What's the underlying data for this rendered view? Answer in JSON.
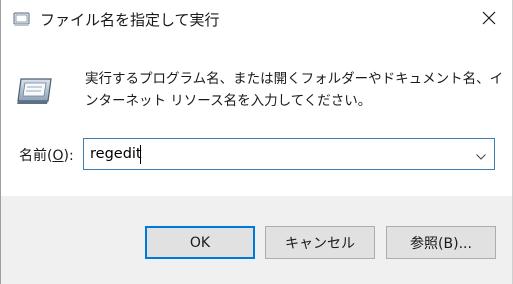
{
  "window": {
    "title": "ファイル名を指定して実行",
    "title_icon": "run-dialog-icon",
    "close_icon": "close-icon"
  },
  "main": {
    "icon": "run-program-icon",
    "description": "実行するプログラム名、または開くフォルダーやドキュメント名、インターネット リソース名を入力してください。",
    "open_label_main": "名前(",
    "open_label_key": "O",
    "open_label_end": "):",
    "command_value": "regedit",
    "dropdown_icon": "chevron-down-icon"
  },
  "buttons": {
    "ok": "OK",
    "cancel": "キャンセル",
    "browse": "参照(B)..."
  },
  "colors": {
    "accent": "#0078d7",
    "footer_bg": "#f0f0f0",
    "button_bg": "#e1e1e1"
  }
}
